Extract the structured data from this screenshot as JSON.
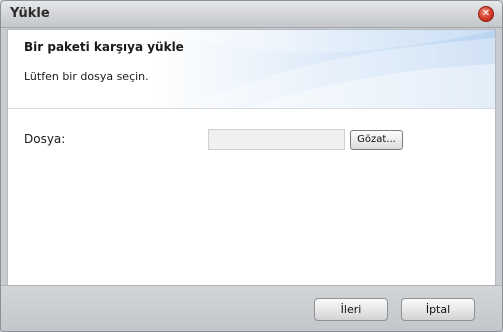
{
  "window": {
    "title": "Yükle",
    "close_symbol": "✕"
  },
  "header": {
    "title": "Bir paketi karşıya yükle",
    "subtitle": "Lütfen bir dosya seçin."
  },
  "form": {
    "file_label": "Dosya:",
    "file_value": "",
    "browse_label": "Gözat..."
  },
  "footer": {
    "next_label": "İleri",
    "cancel_label": "İptal"
  },
  "colors": {
    "close_button": "#d33a26",
    "header_gradient_end": "#b9d3f0"
  },
  "icons": {
    "close": "close-icon"
  }
}
